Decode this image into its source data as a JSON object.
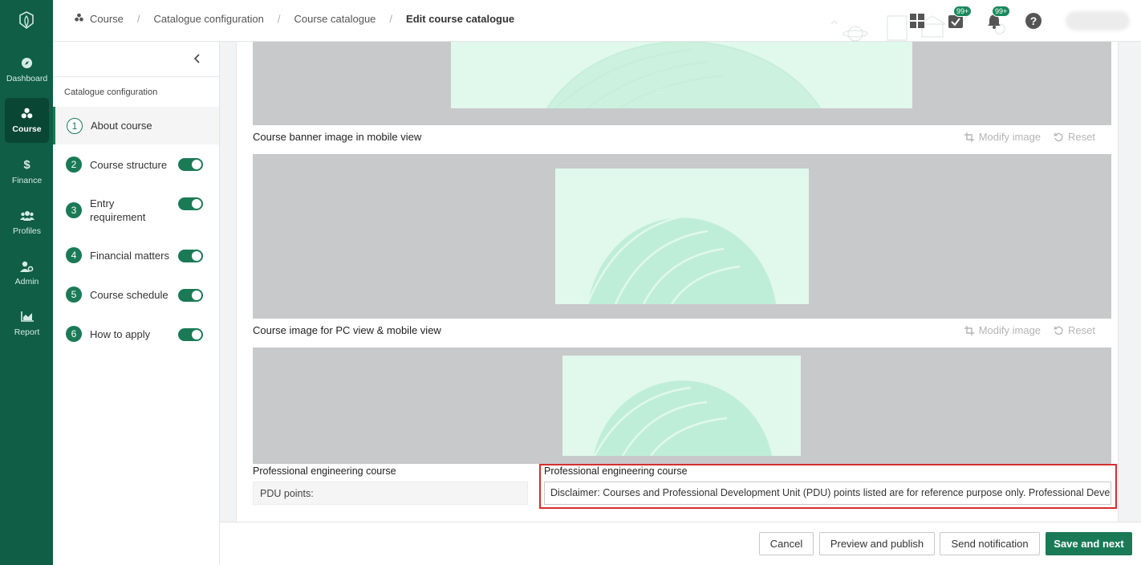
{
  "rail": {
    "items": [
      {
        "label": "Dashboard",
        "icon": "compass-icon"
      },
      {
        "label": "Course",
        "icon": "course-icon"
      },
      {
        "label": "Finance",
        "icon": "dollar-icon"
      },
      {
        "label": "Profiles",
        "icon": "people-icon"
      },
      {
        "label": "Admin",
        "icon": "admin-icon"
      },
      {
        "label": "Report",
        "icon": "chart-icon"
      }
    ]
  },
  "breadcrumb": {
    "items": [
      "Course",
      "Catalogue configuration",
      "Course catalogue"
    ],
    "current": "Edit course catalogue"
  },
  "header": {
    "task_badge": "99+",
    "notification_badge": "99+"
  },
  "sidebar": {
    "section_title": "Catalogue configuration",
    "steps": [
      {
        "num": "1",
        "label": "About course"
      },
      {
        "num": "2",
        "label": "Course structure"
      },
      {
        "num": "3",
        "label": "Entry requirement"
      },
      {
        "num": "4",
        "label": "Financial matters"
      },
      {
        "num": "5",
        "label": "Course schedule"
      },
      {
        "num": "6",
        "label": "How to apply"
      }
    ]
  },
  "main": {
    "mobile_banner_label": "Course banner image in mobile view",
    "course_image_label": "Course image for PC view & mobile view",
    "modify_label": "Modify image",
    "reset_label": "Reset",
    "pdu_label": "Professional engineering course",
    "pdu_value": "PDU points:",
    "disclaimer_label": "Professional engineering course",
    "disclaimer_value": "Disclaimer: Courses and Professional Development Unit (PDU) points listed are for reference purpose only. Professional Development"
  },
  "footer": {
    "cancel": "Cancel",
    "preview": "Preview and publish",
    "notify": "Send notification",
    "save": "Save and next"
  },
  "colors": {
    "brand": "#0f5e45",
    "accent": "#1a7a56",
    "highlight": "#d32f2f"
  }
}
